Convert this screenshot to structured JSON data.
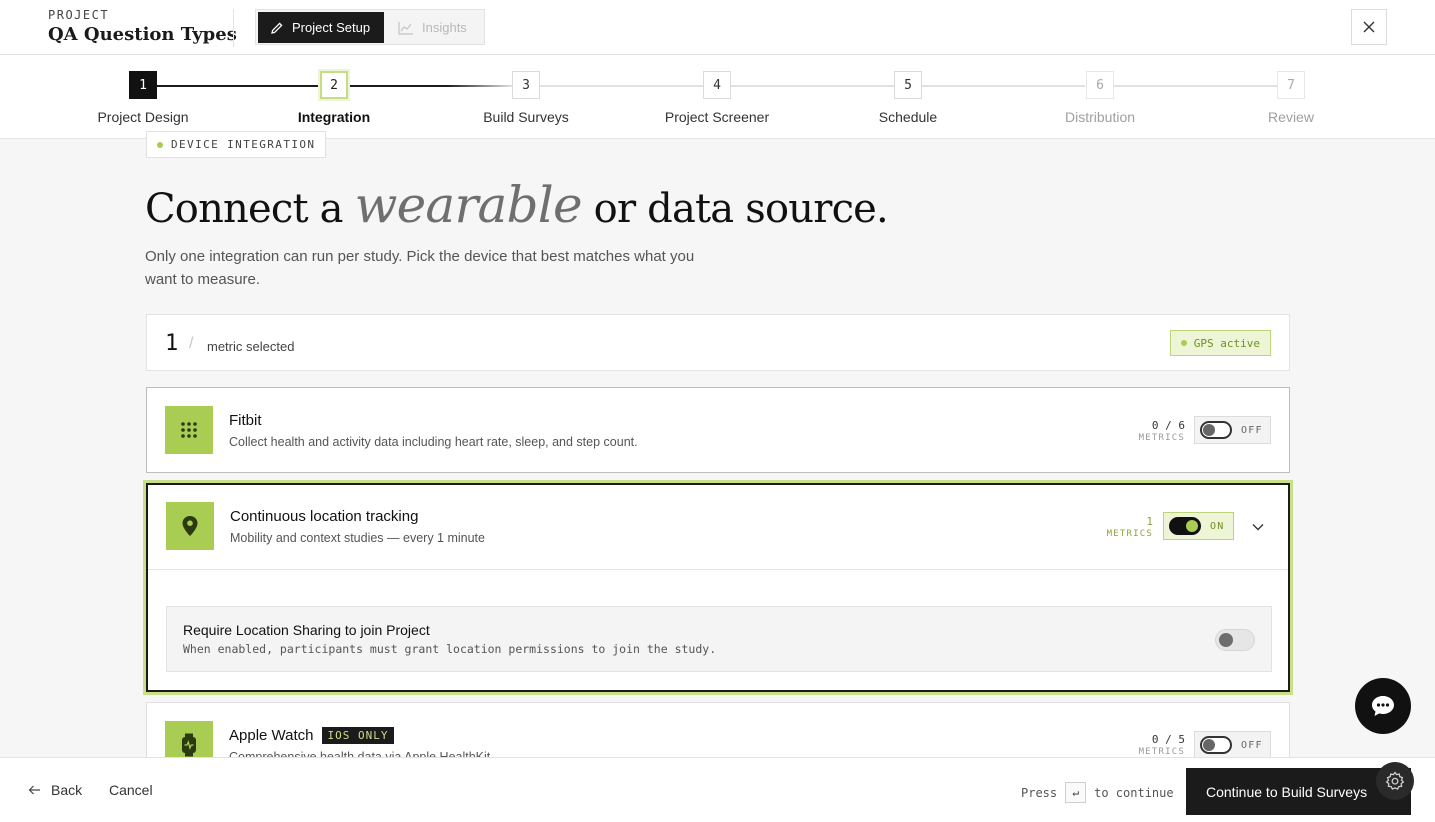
{
  "header": {
    "kicker": "PROJECT",
    "project_name": "QA Question Types",
    "tabs": [
      {
        "label": "Project Setup",
        "icon": "pencil-icon",
        "active": true
      },
      {
        "label": "Insights",
        "icon": "chart-icon",
        "active": false
      }
    ],
    "close_icon": "close-icon"
  },
  "stepper": {
    "current": 2,
    "steps": [
      {
        "number": "1",
        "label": "Project Design"
      },
      {
        "number": "2",
        "label": "Integration"
      },
      {
        "number": "3",
        "label": "Build Surveys"
      },
      {
        "number": "4",
        "label": "Project Screener"
      },
      {
        "number": "5",
        "label": "Schedule"
      },
      {
        "number": "6",
        "label": "Distribution"
      },
      {
        "number": "7",
        "label": "Review"
      }
    ]
  },
  "section": {
    "chip": "DEVICE INTEGRATION",
    "headline_before": "Connect a ",
    "headline_italic": "wearable",
    "headline_after": " or data source.",
    "subtitle": "Only one integration can run per study. Pick the device that best matches what you want to measure."
  },
  "summary": {
    "count": "1",
    "slash": "/",
    "label": "metric selected",
    "gps_badge": "GPS active"
  },
  "integrations": [
    {
      "name": "Fitbit",
      "description": "Collect health and activity data including heart rate, sleep, and step count.",
      "icon": "dots-grid-icon",
      "metrics": "0 / 6",
      "metrics_label": "METRICS",
      "toggle_state": "OFF"
    },
    {
      "name": "Continuous location tracking",
      "description": "Mobility and context studies — every 1 minute",
      "icon": "location-pin-icon",
      "metrics": "1",
      "metrics_label": "METRICS",
      "toggle_state": "ON",
      "expanded": true,
      "option": {
        "title": "Require Location Sharing to join Project",
        "description": "When enabled, participants must grant location permissions to join the study.",
        "enabled": false
      }
    },
    {
      "name": "Apple Watch",
      "badge": "IOS ONLY",
      "description": "Comprehensive health data via Apple HealthKit",
      "icon": "watch-icon",
      "metrics": "0 / 5",
      "metrics_label": "METRICS",
      "toggle_state": "OFF"
    }
  ],
  "footer": {
    "back": "Back",
    "cancel": "Cancel",
    "press": "Press",
    "key": "↵",
    "to_continue": "to continue",
    "continue_label": "Continue to Build Surveys"
  },
  "colors": {
    "accent": "#a9cc52",
    "dark": "#1b1b1b",
    "accent_text": "#6f8f22"
  }
}
